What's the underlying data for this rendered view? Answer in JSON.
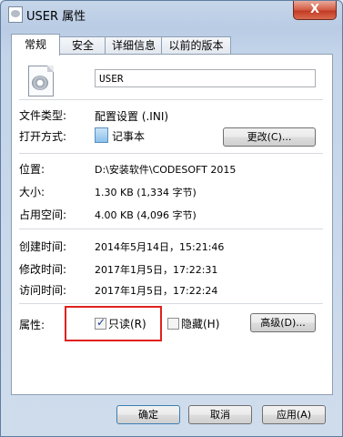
{
  "window": {
    "title": "USER 属性",
    "close_label": "X"
  },
  "tabs": [
    {
      "label": "常规",
      "active": true
    },
    {
      "label": "安全",
      "active": false
    },
    {
      "label": "详细信息",
      "active": false
    },
    {
      "label": "以前的版本",
      "active": false
    }
  ],
  "general": {
    "file_name": "USER",
    "file_type_label": "文件类型:",
    "file_type_value": "配置设置 (.INI)",
    "opens_with_label": "打开方式:",
    "opens_with_value": "记事本",
    "change_button": "更改(C)...",
    "location_label": "位置:",
    "location_value": "D:\\安装软件\\CODESOFT 2015",
    "size_label": "大小:",
    "size_value": "1.30 KB (1,334 字节)",
    "size_on_disk_label": "占用空间:",
    "size_on_disk_value": "4.00 KB (4,096 字节)",
    "created_label": "创建时间:",
    "created_value": "2014年5月14日，15:21:46",
    "modified_label": "修改时间:",
    "modified_value": "2017年1月5日，17:22:31",
    "accessed_label": "访问时间:",
    "accessed_value": "2017年1月5日，17:22:24",
    "attributes_label": "属性:",
    "readonly_label": "只读(R)",
    "readonly_checked": true,
    "hidden_label": "隐藏(H)",
    "hidden_checked": false,
    "advanced_button": "高级(D)..."
  },
  "footer": {
    "ok": "确定",
    "cancel": "取消",
    "apply": "应用(A)"
  },
  "colors": {
    "highlight_box": "#e0221c"
  }
}
